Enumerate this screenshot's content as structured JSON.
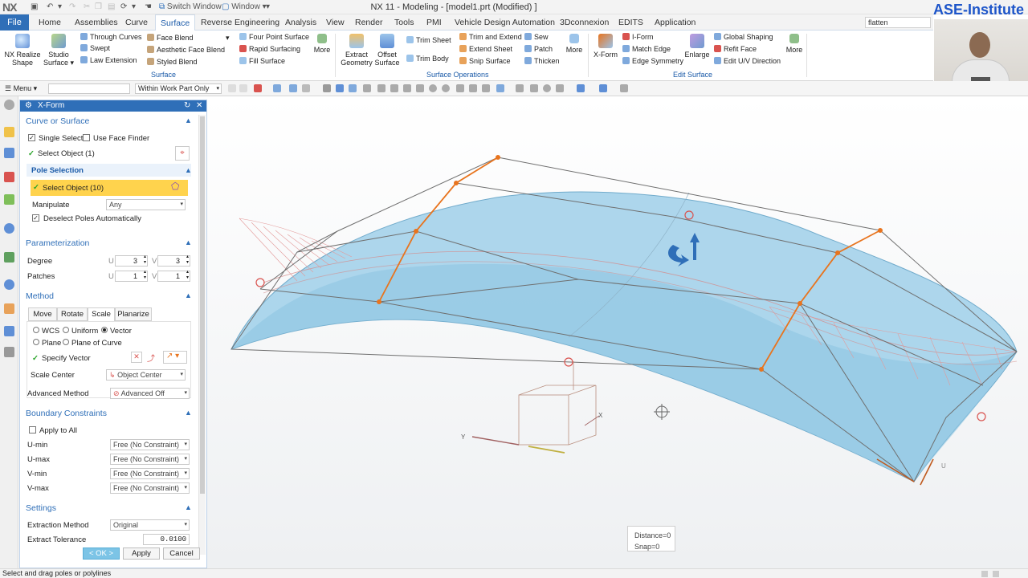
{
  "titlebar": {
    "logo": "NX",
    "switch_window": "Switch Window",
    "window_menu": "Window",
    "title": "NX 11 - Modeling - [model1.prt (Modified) ]",
    "brand": "ASE-Institute"
  },
  "tabs": {
    "file": "File",
    "items": [
      "Home",
      "Assemblies",
      "Curve",
      "Surface",
      "Reverse Engineering",
      "Analysis",
      "View",
      "Render",
      "Tools",
      "PMI",
      "Vehicle Design Automation",
      "3Dconnexion",
      "EDITS",
      "Application"
    ],
    "active": "Surface",
    "search_value": "flatten"
  },
  "ribbon": {
    "nx_realize_shape": "NX Realize Shape",
    "studio_surface": "Studio Surface",
    "through_curves": "Through Curves",
    "swept": "Swept",
    "law_extension": "Law Extension",
    "face_blend": "Face Blend",
    "aesthetic_face_blend": "Aesthetic Face Blend",
    "styled_blend": "Styled Blend",
    "four_point_surface": "Four Point Surface",
    "rapid_surfacing": "Rapid Surfacing",
    "fill_surface": "Fill Surface",
    "more": "More",
    "extract_geometry": "Extract Geometry",
    "offset_surface": "Offset Surface",
    "trim_sheet": "Trim Sheet",
    "trim_body": "Trim Body",
    "trim_and_extend": "Trim and Extend",
    "extend_sheet": "Extend Sheet",
    "snip_surface": "Snip Surface",
    "sew": "Sew",
    "patch": "Patch",
    "thicken": "Thicken",
    "x_form": "X-Form",
    "i_form": "I-Form",
    "match_edge": "Match Edge",
    "edge_symmetry": "Edge Symmetry",
    "enlarge": "Enlarge",
    "global_shaping": "Global Shaping",
    "refit_face": "Refit Face",
    "edit_uv_direction": "Edit U/V Direction",
    "group_surface": "Surface",
    "group_surface_operations": "Surface Operations",
    "group_edit_surface": "Edit Surface"
  },
  "toolbar": {
    "menu": "Menu",
    "filter_value": "",
    "scope_value": "Within Work Part Only"
  },
  "dialog": {
    "title": "X-Form",
    "curve_or_surface": {
      "heading": "Curve or Surface",
      "single_select": "Single Select",
      "single_select_checked": true,
      "use_face_finder": "Use Face Finder",
      "use_face_finder_checked": false,
      "select_object": "Select Object (1)"
    },
    "pole_selection": {
      "heading": "Pole Selection",
      "select_object": "Select Object (10)",
      "manipulate_label": "Manipulate",
      "manipulate_value": "Any",
      "deselect_poles": "Deselect Poles Automatically",
      "deselect_poles_checked": true
    },
    "parameterization": {
      "heading": "Parameterization",
      "degree_label": "Degree",
      "patches_label": "Patches",
      "u": "U",
      "v": "V",
      "degree_u": "3",
      "degree_v": "3",
      "patches_u": "1",
      "patches_v": "1"
    },
    "method": {
      "heading": "Method",
      "tabs": [
        "Move",
        "Rotate",
        "Scale",
        "Planarize"
      ],
      "active_tab": "Scale",
      "wcs": "WCS",
      "uniform": "Uniform",
      "vector": "Vector",
      "plane": "Plane",
      "plane_of_curve": "Plane of Curve",
      "specify_vector": "Specify Vector",
      "scale_center_label": "Scale Center",
      "scale_center_value": "Object Center",
      "advanced_method_label": "Advanced Method",
      "advanced_method_value": "Advanced Off"
    },
    "boundary": {
      "heading": "Boundary Constraints",
      "apply_to_all": "Apply to All",
      "apply_to_all_checked": false,
      "rows": [
        {
          "label": "U-min",
          "value": "Free (No Constraint)"
        },
        {
          "label": "U-max",
          "value": "Free (No Constraint)"
        },
        {
          "label": "V-min",
          "value": "Free (No Constraint)"
        },
        {
          "label": "V-max",
          "value": "Free (No Constraint)"
        }
      ]
    },
    "settings": {
      "heading": "Settings",
      "extraction_method_label": "Extraction Method",
      "extraction_method_value": "Original",
      "extract_tolerance_label": "Extract Tolerance",
      "extract_tolerance_value": "0.0100"
    },
    "buttons": {
      "ok": "< OK >",
      "apply": "Apply",
      "cancel": "Cancel"
    }
  },
  "viewport": {
    "distance": "Distance=0",
    "snap": "Snap=0",
    "axis_y": "Y",
    "axis_x": "X",
    "axis_u": "U"
  },
  "status": {
    "message": "Select and drag poles or polylines"
  },
  "colors": {
    "accent": "#2f6fb8",
    "surface": "#a8d4ea",
    "pole_line": "#e8741e",
    "highlight": "#ffd34d"
  }
}
